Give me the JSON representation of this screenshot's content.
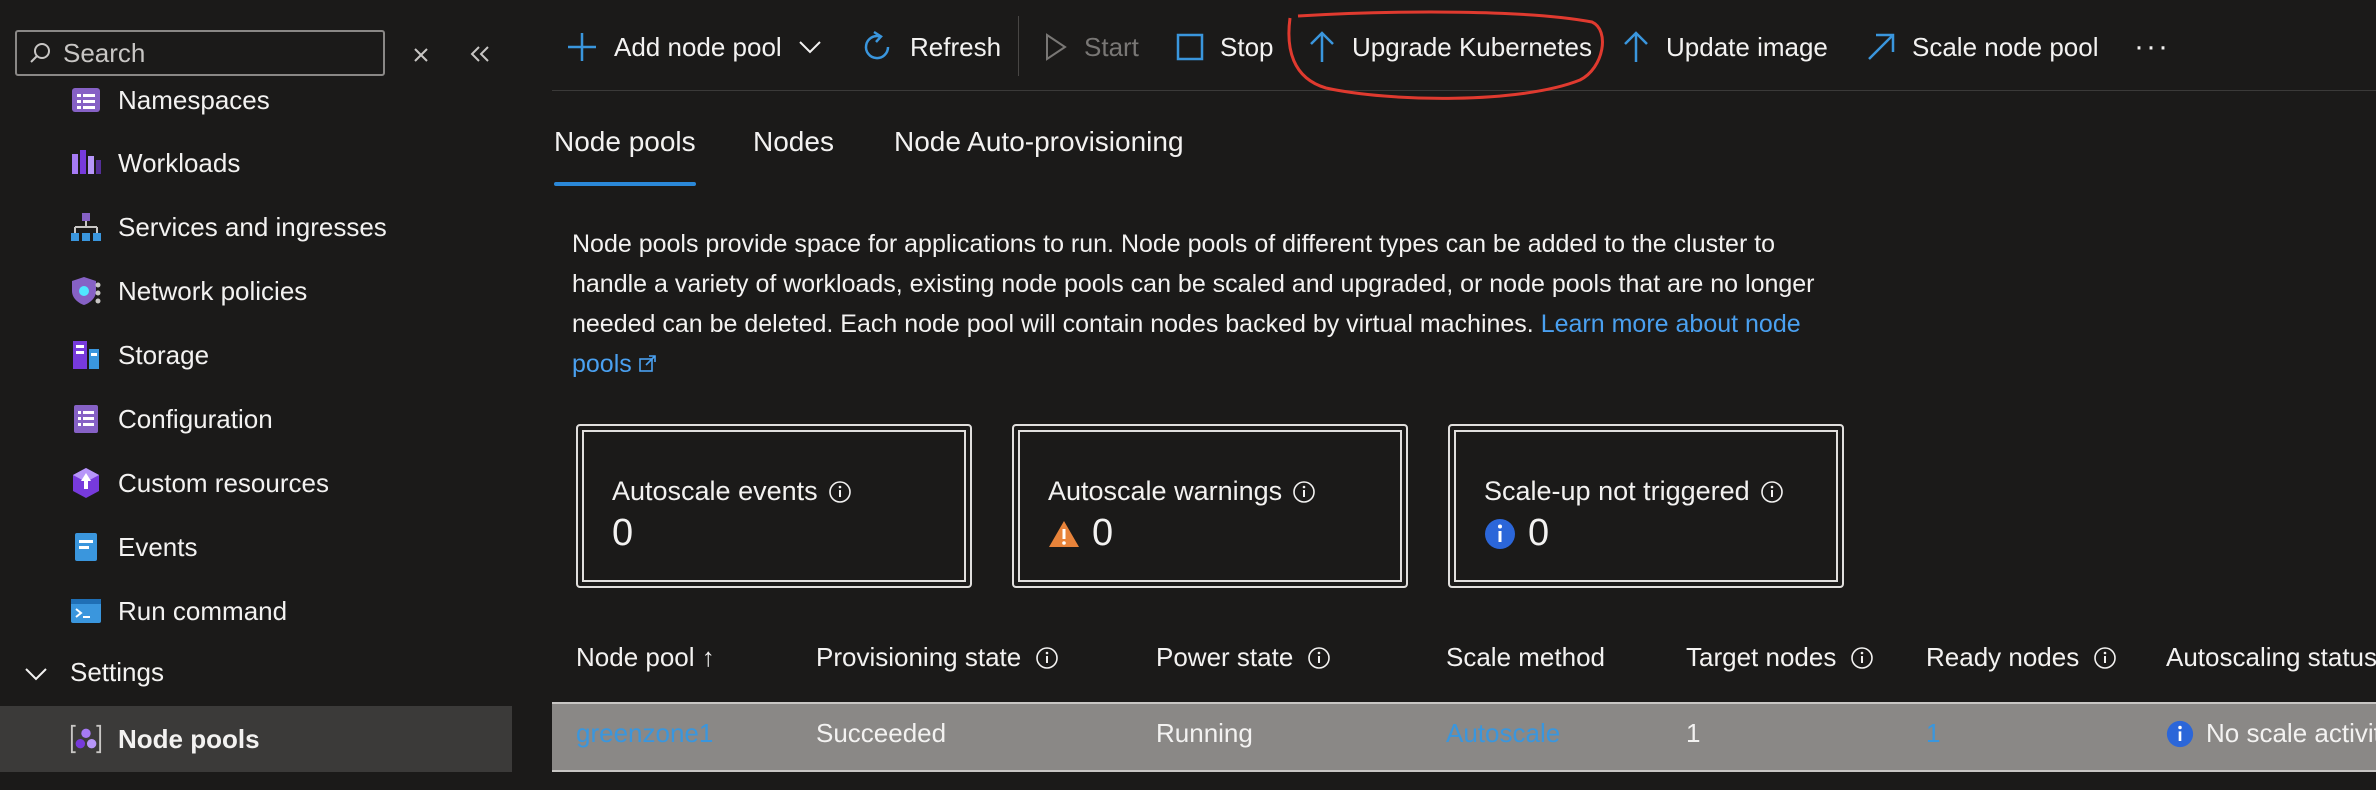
{
  "sidebar": {
    "search": {
      "placeholder": "Search",
      "value": ""
    },
    "items": [
      {
        "label": "Namespaces",
        "icon": "namespaces-icon"
      },
      {
        "label": "Workloads",
        "icon": "workloads-icon"
      },
      {
        "label": "Services and ingresses",
        "icon": "services-icon"
      },
      {
        "label": "Network policies",
        "icon": "network-policies-icon"
      },
      {
        "label": "Storage",
        "icon": "storage-icon"
      },
      {
        "label": "Configuration",
        "icon": "configuration-icon"
      },
      {
        "label": "Custom resources",
        "icon": "custom-resources-icon"
      },
      {
        "label": "Events",
        "icon": "events-icon"
      },
      {
        "label": "Run command",
        "icon": "run-command-icon"
      }
    ],
    "settings_group": {
      "label": "Settings"
    },
    "selected_item": {
      "label": "Node pools",
      "icon": "node-pools-icon"
    }
  },
  "toolbar": {
    "add_node_pool": "Add node pool",
    "refresh": "Refresh",
    "start": "Start",
    "stop": "Stop",
    "upgrade_kubernetes": "Upgrade Kubernetes",
    "update_image": "Update image",
    "scale_node_pool": "Scale node pool",
    "more": "···"
  },
  "tabs": [
    {
      "label": "Node pools",
      "active": true
    },
    {
      "label": "Nodes",
      "active": false
    },
    {
      "label": "Node Auto-provisioning",
      "active": false
    }
  ],
  "description": {
    "text": "Node pools provide space for applications to run. Node pools of different types can be added to the cluster to handle a variety of workloads, existing node pools can be scaled and upgraded, or node pools that are no longer needed can be deleted. Each node pool will contain nodes backed by virtual machines.",
    "link": "Learn more about node pools"
  },
  "cards": [
    {
      "title": "Autoscale events",
      "value": "0"
    },
    {
      "title": "Autoscale warnings",
      "value": "0"
    },
    {
      "title": "Scale-up not triggered",
      "value": "0"
    }
  ],
  "table": {
    "headers": {
      "node_pool": "Node pool ↑",
      "provisioning_state": "Provisioning state",
      "power_state": "Power state",
      "scale_method": "Scale method",
      "target_nodes": "Target nodes",
      "ready_nodes": "Ready nodes",
      "autoscaling_status": "Autoscaling status"
    },
    "rows": [
      {
        "node_pool": "greenzone1",
        "provisioning_state": "Succeeded",
        "power_state": "Running",
        "scale_method": "Autoscale",
        "target_nodes": "1",
        "ready_nodes": "1",
        "autoscaling_status": "No scale activity"
      }
    ]
  },
  "colors": {
    "background": "#1b1a19",
    "accent": "#2b88d8",
    "link": "#4aa0f0",
    "highlight_annotation": "#e03a2f",
    "selected_row": "#8a8886"
  }
}
